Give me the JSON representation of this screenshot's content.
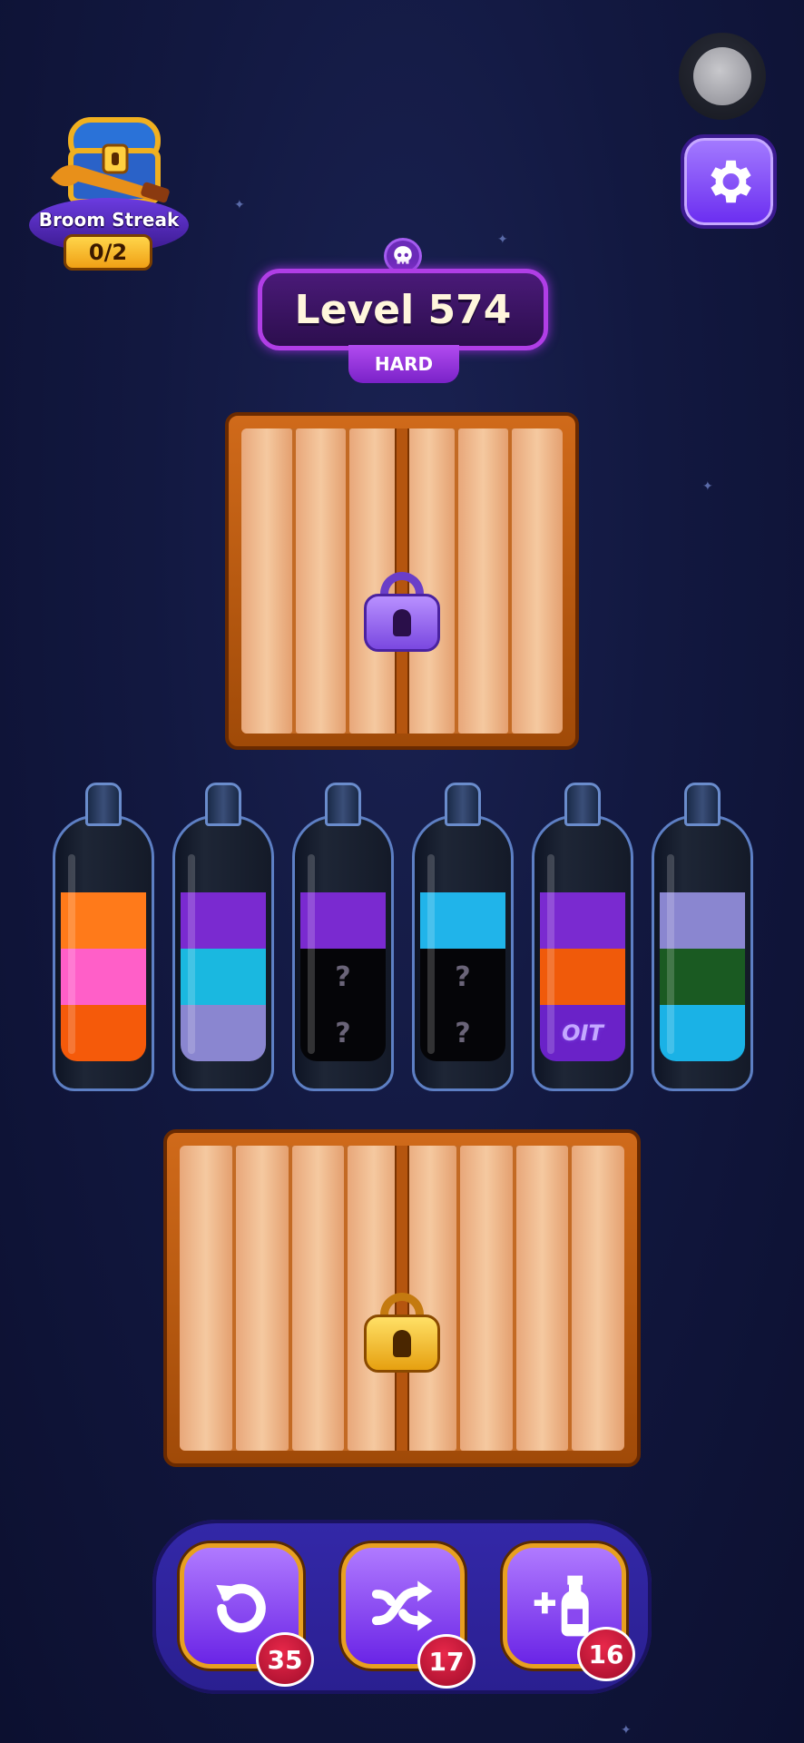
{
  "header": {
    "streak_label": "Broom Streak",
    "streak_count": "0/2",
    "level_label": "Level 574",
    "difficulty": "HARD"
  },
  "icons": {
    "assist": "assist-touch-icon",
    "settings": "gear-icon",
    "skull": "skull-icon",
    "chest": "treasure-chest-icon"
  },
  "bottles": [
    {
      "layers": [
        {
          "color": "#ff7a1a"
        },
        {
          "color": "#ff5fc8"
        },
        {
          "color": "#f55a0a"
        }
      ]
    },
    {
      "layers": [
        {
          "color": "#7a2ad0"
        },
        {
          "color": "#1ab8e0"
        },
        {
          "color": "#8a86d0"
        }
      ]
    },
    {
      "layers": [
        {
          "color": "#7a2ad0"
        },
        {
          "color": "#050508",
          "text": "?"
        },
        {
          "color": "#050508",
          "text": "?"
        }
      ]
    },
    {
      "layers": [
        {
          "color": "#20b4ea"
        },
        {
          "color": "#050508",
          "text": "?"
        },
        {
          "color": "#050508",
          "text": "?"
        }
      ]
    },
    {
      "layers": [
        {
          "color": "#7a2ad0"
        },
        {
          "color": "#f05a0a"
        },
        {
          "color": "#6a22c8",
          "key": "OIT"
        }
      ]
    },
    {
      "layers": [
        {
          "color": "#8a86d0"
        },
        {
          "color": "#1a5a22"
        },
        {
          "color": "#1ab2e6"
        }
      ]
    }
  ],
  "toolbar": {
    "undo_count": "35",
    "shuffle_count": "17",
    "add_bottle_count": "16"
  }
}
